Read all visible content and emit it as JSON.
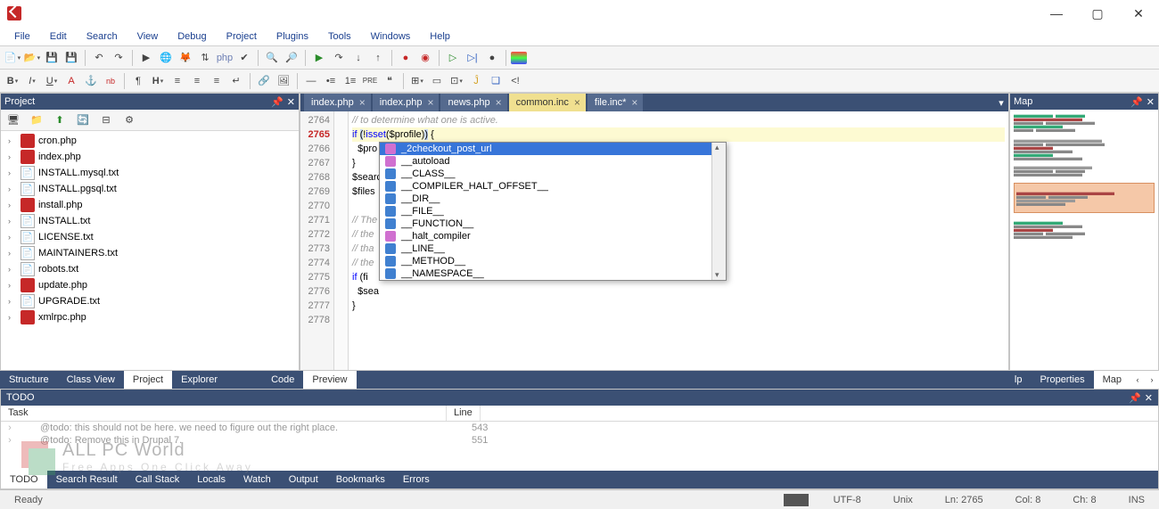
{
  "menubar": [
    "File",
    "Edit",
    "Search",
    "View",
    "Debug",
    "Project",
    "Plugins",
    "Tools",
    "Windows",
    "Help"
  ],
  "project": {
    "title": "Project",
    "files": [
      {
        "name": "cron.php",
        "type": "php"
      },
      {
        "name": "index.php",
        "type": "php"
      },
      {
        "name": "INSTALL.mysql.txt",
        "type": "txt"
      },
      {
        "name": "INSTALL.pgsql.txt",
        "type": "txt"
      },
      {
        "name": "install.php",
        "type": "php"
      },
      {
        "name": "INSTALL.txt",
        "type": "txt"
      },
      {
        "name": "LICENSE.txt",
        "type": "txt"
      },
      {
        "name": "MAINTAINERS.txt",
        "type": "txt"
      },
      {
        "name": "robots.txt",
        "type": "txt"
      },
      {
        "name": "update.php",
        "type": "php"
      },
      {
        "name": "UPGRADE.txt",
        "type": "txt"
      },
      {
        "name": "xmlrpc.php",
        "type": "php"
      }
    ]
  },
  "editor": {
    "tabs": [
      {
        "label": "index.php",
        "active": false
      },
      {
        "label": "index.php",
        "active": false
      },
      {
        "label": "news.php",
        "active": false
      },
      {
        "label": "common.inc",
        "active": true
      },
      {
        "label": "file.inc*",
        "active": false
      }
    ],
    "line_start": 2764,
    "current_line": 2765,
    "lines": [
      {
        "type": "comment",
        "text": "// to determine what one is active."
      },
      {
        "type": "code",
        "text": "if (!isset($profile)) {",
        "highlight": true
      },
      {
        "type": "code",
        "text": "  $pro",
        "tail": "');"
      },
      {
        "type": "code",
        "text": "}"
      },
      {
        "type": "code",
        "text": "$searc"
      },
      {
        "type": "code",
        "text": "$files"
      },
      {
        "type": "blank",
        "text": ""
      },
      {
        "type": "comment",
        "text": "// The                                     tions of modules and"
      },
      {
        "type": "comment",
        "text": "// the                                     tine in the same way"
      },
      {
        "type": "comment",
        "text": "// tha                                     void changing anything"
      },
      {
        "type": "comment",
        "text": "// the                                     ectories."
      },
      {
        "type": "code",
        "text": "if (fi"
      },
      {
        "type": "code",
        "text": "  $sea"
      },
      {
        "type": "code",
        "text": "}"
      },
      {
        "type": "blank",
        "text": ""
      }
    ],
    "autocomplete": [
      {
        "label": "_2checkout_post_url",
        "icon": "pink",
        "selected": true
      },
      {
        "label": "__autoload",
        "icon": "pink"
      },
      {
        "label": "__CLASS__",
        "icon": "blue"
      },
      {
        "label": "__COMPILER_HALT_OFFSET__",
        "icon": "blue"
      },
      {
        "label": "__DIR__",
        "icon": "blue"
      },
      {
        "label": "__FILE__",
        "icon": "blue"
      },
      {
        "label": "__FUNCTION__",
        "icon": "blue"
      },
      {
        "label": "__halt_compiler",
        "icon": "pink"
      },
      {
        "label": "__LINE__",
        "icon": "blue"
      },
      {
        "label": "__METHOD__",
        "icon": "blue"
      },
      {
        "label": "__NAMESPACE__",
        "icon": "blue"
      }
    ],
    "bottom_tabs": [
      "Code",
      "Preview"
    ],
    "bottom_active": "Preview"
  },
  "left_bottom_tabs": [
    "Structure",
    "Class View",
    "Project",
    "Explorer"
  ],
  "left_bottom_active": "Project",
  "right_bottom_tabs": [
    "lp",
    "Properties",
    "Map"
  ],
  "right_bottom_active": "Map",
  "map": {
    "title": "Map"
  },
  "todo": {
    "title": "TODO",
    "cols": [
      "Task",
      "Line"
    ],
    "rows": [
      {
        "task": "@todo: this should not be here. we need to figure out the right place.",
        "line": "543"
      },
      {
        "task": "@todo: Remove this in Drupal 7.",
        "line": "551"
      }
    ],
    "tabs": [
      "TODO",
      "Search Result",
      "Call Stack",
      "Locals",
      "Watch",
      "Output",
      "Bookmarks",
      "Errors"
    ],
    "tab_active": "TODO"
  },
  "status": {
    "ready": "Ready",
    "encoding": "UTF-8",
    "eol": "Unix",
    "ln": "Ln: 2765",
    "col": "Col: 8",
    "ch": "Ch: 8",
    "ins": "INS"
  },
  "watermark": {
    "line1": "ALL PC World",
    "line2": "Free Apps One Click Away"
  }
}
